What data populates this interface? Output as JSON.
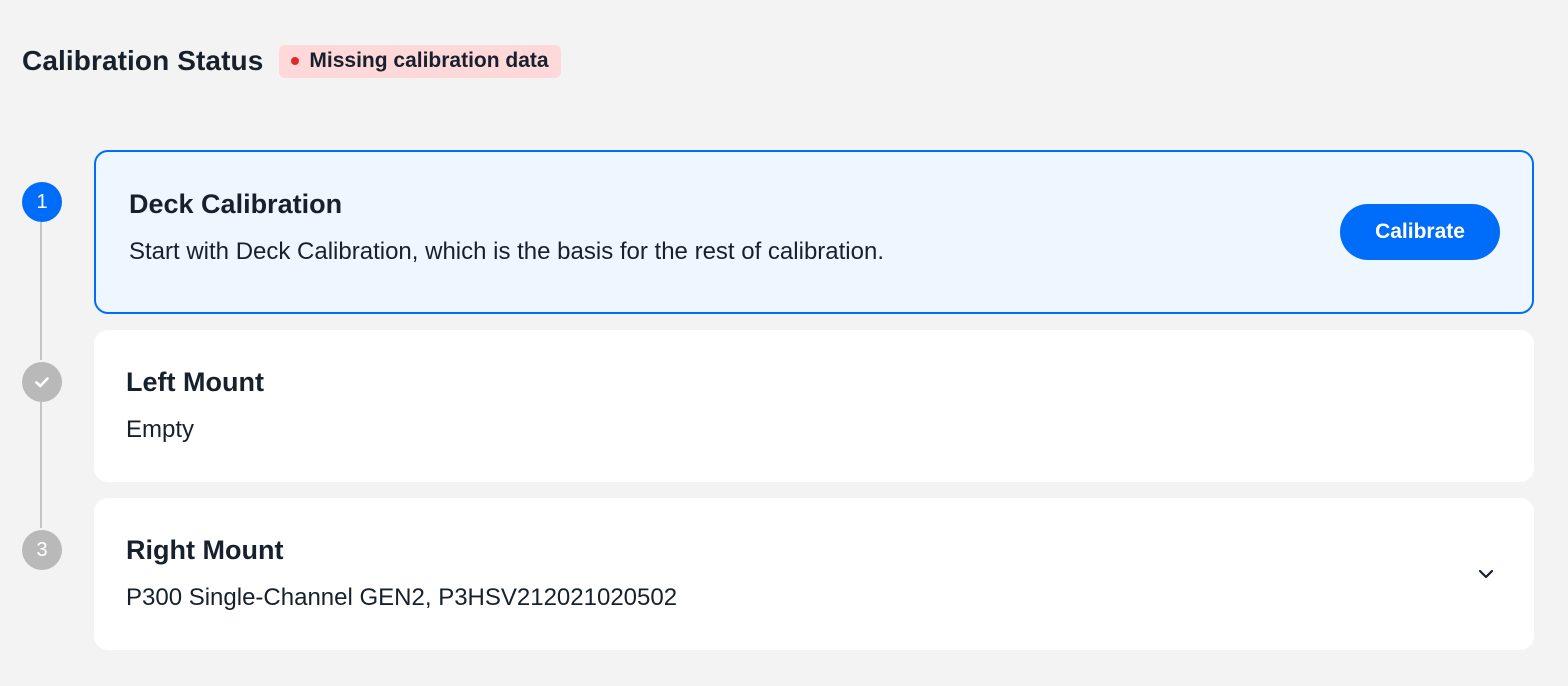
{
  "header": {
    "title": "Calibration Status",
    "status_badge": "Missing calibration data",
    "status_color": "#df2a2a"
  },
  "steps": [
    {
      "marker": "1",
      "state": "active",
      "title": "Deck Calibration",
      "description": "Start with Deck Calibration, which is the basis for the rest of calibration.",
      "action_label": "Calibrate"
    },
    {
      "marker_icon": "check-icon",
      "state": "complete",
      "title": "Left Mount",
      "description": "Empty"
    },
    {
      "marker": "3",
      "state": "pending",
      "title": "Right Mount",
      "description": "P300 Single-Channel GEN2, P3HSV212021020502",
      "toggle_icon": "chevron-down-icon"
    }
  ],
  "colors": {
    "accent": "#006cfa",
    "active_card_bg": "#eef6ff",
    "badge_bg": "#ffd9d9",
    "inactive_marker": "#b9b9b9",
    "page_bg": "#f3f3f3"
  }
}
